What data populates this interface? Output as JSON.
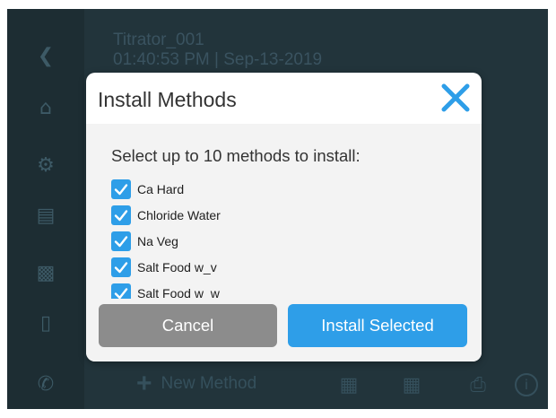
{
  "background": {
    "device": {
      "name": "Titrator_001",
      "datetime": "01:40:53 PM | Sep-13-2019"
    },
    "sidebar": {
      "icons": [
        "back-icon",
        "home-icon",
        "settings-icon",
        "document-icon",
        "methods-icon",
        "device-icon",
        "phone-icon"
      ]
    },
    "bottom_bar": {
      "new_method_label": "New Method",
      "icons": [
        "import-icon",
        "export-icon",
        "print-icon",
        "info-icon"
      ]
    }
  },
  "dialog": {
    "title": "Install Methods",
    "close_icon": "close-icon",
    "instruction": "Select up to 10 methods to install:",
    "methods": [
      {
        "name": "Ca Hard",
        "checked": true
      },
      {
        "name": "Chloride Water",
        "checked": true
      },
      {
        "name": "Na Veg",
        "checked": true
      },
      {
        "name": "Salt Food w_v",
        "checked": true
      },
      {
        "name": "Salt Food w_w",
        "checked": true
      }
    ],
    "cancel_label": "Cancel",
    "install_label": "Install Selected"
  },
  "colors": {
    "accent": "#2e9ee8",
    "cancel": "#8c8c8c",
    "background": "#22343b"
  }
}
